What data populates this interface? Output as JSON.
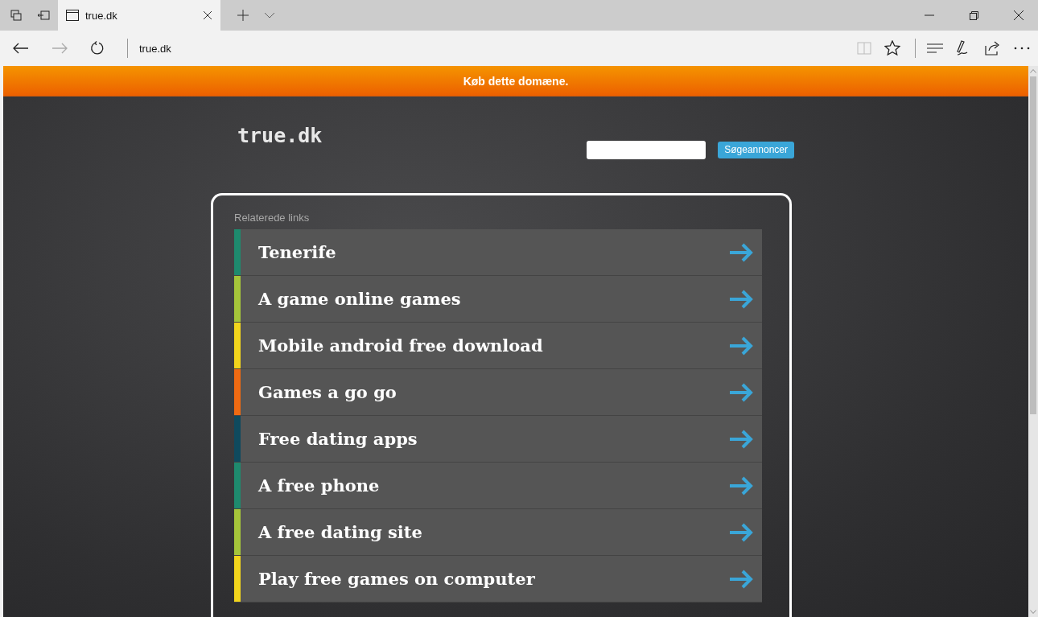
{
  "browser": {
    "tab": {
      "title": "true.dk",
      "selected": true
    },
    "address": "true.dk"
  },
  "banner": {
    "text": "Køb dette domæne."
  },
  "page": {
    "logo": "true.dk",
    "search": {
      "button": "Søgeannoncer"
    },
    "links": {
      "heading": "Relaterede links",
      "items": [
        {
          "label": "Tenerife",
          "color": "#1e8a6e"
        },
        {
          "label": "A game online games",
          "color": "#a5c53a"
        },
        {
          "label": "Mobile android free download",
          "color": "#f2d51c"
        },
        {
          "label": "Games a go go",
          "color": "#ef6a12"
        },
        {
          "label": "Free dating apps",
          "color": "#0f4a5e"
        },
        {
          "label": "A free phone",
          "color": "#1e8a6e"
        },
        {
          "label": "A free dating site",
          "color": "#a5c53a"
        },
        {
          "label": "Play free games on computer",
          "color": "#f2d51c"
        }
      ]
    }
  }
}
